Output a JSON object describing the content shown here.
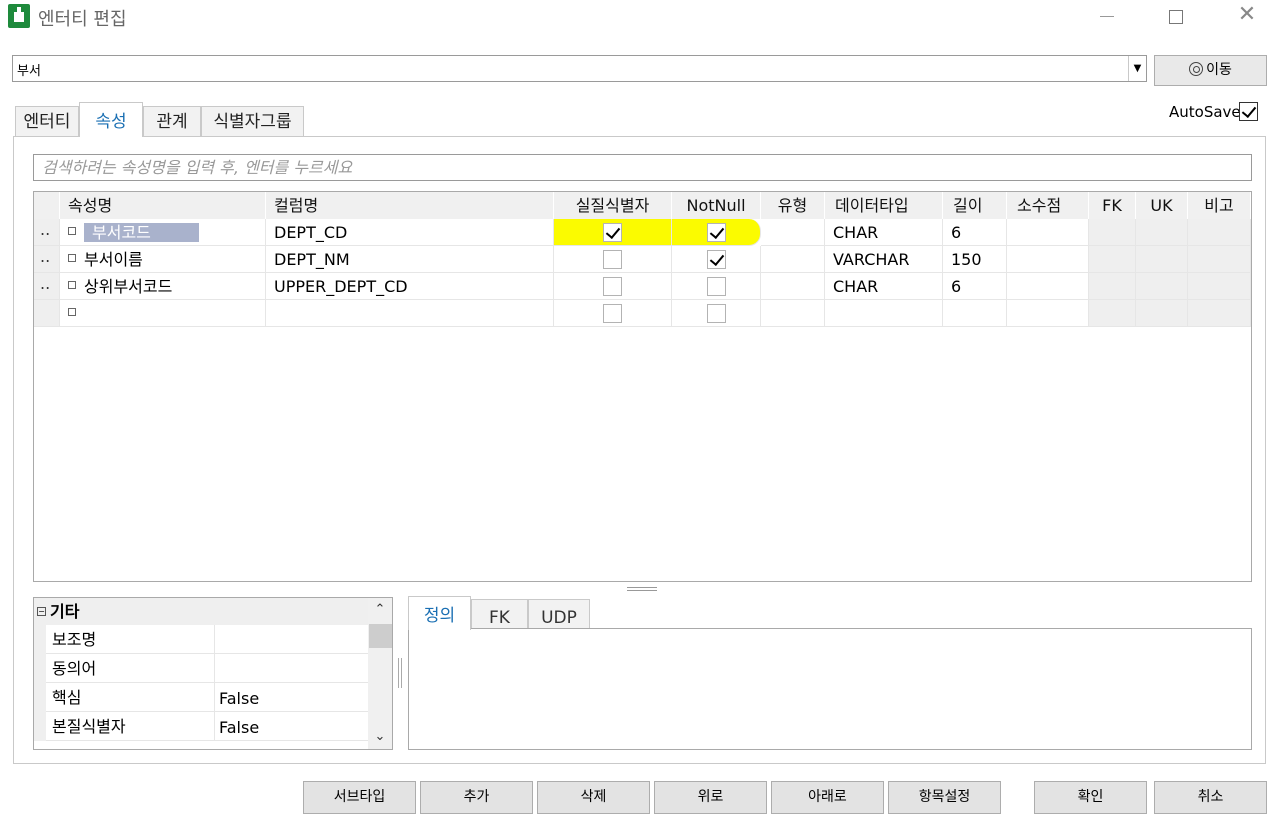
{
  "window": {
    "title": "엔터티 편집",
    "minimize": "",
    "maximize": "",
    "close": "✕"
  },
  "entity_select": {
    "value": "부서",
    "arrow": "▼"
  },
  "go_button": {
    "label": "이동"
  },
  "tabs": [
    {
      "label": "엔터티",
      "active": false
    },
    {
      "label": "속성",
      "active": true
    },
    {
      "label": "관계",
      "active": false
    },
    {
      "label": "식별자그룹",
      "active": false
    }
  ],
  "autosave": {
    "label": "AutoSave",
    "checked": true,
    "check_mark": "✓"
  },
  "search": {
    "placeholder": "검색하려는 속성명을 입력 후, 엔터를 누르세요",
    "value": ""
  },
  "grid": {
    "columns": [
      "속성명",
      "컬럼명",
      "실질식별자",
      "NotNull",
      "유형",
      "데이터타입",
      "길이",
      "소수점",
      "FK",
      "UK",
      "비고"
    ],
    "rows": [
      {
        "marker": "..",
        "name": "부서코드",
        "column": "DEPT_CD",
        "identifier": true,
        "notnull": true,
        "type": "",
        "datatype": "CHAR",
        "length": "6",
        "decimal": "",
        "selected": true
      },
      {
        "marker": "..",
        "name": "부서이름",
        "column": "DEPT_NM",
        "identifier": false,
        "notnull": true,
        "type": "",
        "datatype": "VARCHAR",
        "length": "150",
        "decimal": "",
        "selected": false
      },
      {
        "marker": "..",
        "name": "상위부서코드",
        "column": "UPPER_DEPT_CD",
        "identifier": false,
        "notnull": false,
        "type": "",
        "datatype": "CHAR",
        "length": "6",
        "decimal": "",
        "selected": false
      },
      {
        "marker": "",
        "name": "",
        "column": "",
        "identifier": false,
        "notnull": false,
        "type": "",
        "datatype": "",
        "length": "",
        "decimal": "",
        "selected": false
      }
    ],
    "highlight_color": "#fbfb00"
  },
  "properties": {
    "category": "기타",
    "collapse_icon": "−",
    "rows": [
      {
        "key": "보조명",
        "value": ""
      },
      {
        "key": "동의어",
        "value": ""
      },
      {
        "key": "핵심",
        "value": "False"
      },
      {
        "key": "본질식별자",
        "value": "False"
      }
    ],
    "scroll_up": "⌃",
    "scroll_down": "⌄"
  },
  "bottom_tabs": [
    {
      "label": "정의",
      "active": true
    },
    {
      "label": "FK",
      "active": false
    },
    {
      "label": "UDP",
      "active": false
    }
  ],
  "buttons": {
    "subtype": "서브타입",
    "add": "추가",
    "delete": "삭제",
    "up": "위로",
    "down": "아래로",
    "item_settings": "항목설정",
    "ok": "확인",
    "cancel": "취소"
  },
  "colors": {
    "accent": "#1a6fb3",
    "app_icon": "#1e8a3c",
    "selection": "#a9b2cc"
  }
}
